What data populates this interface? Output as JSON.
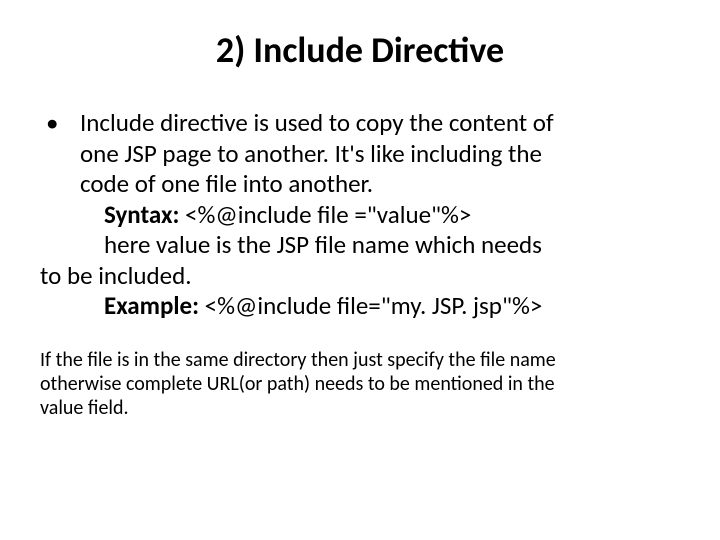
{
  "title": "2) Include Directive",
  "bullet_dot": "•",
  "para": {
    "l1": "Include directive is used to copy the content of",
    "l2": "one JSP page to another. It's like including the",
    "l3": "code of one file into another."
  },
  "syntax": {
    "label": "Syntax:",
    "text": " <%@include file =\"value\"%>"
  },
  "desc": {
    "l1": "here value is the JSP file name which needs",
    "l2": "to be included."
  },
  "example": {
    "label": "Example:",
    "text": " <%@include file=\"my. JSP. jsp\"%>"
  },
  "note": {
    "l1": "If the file is in the same directory then just specify the file name",
    "l2": "otherwise complete URL(or path) needs to be mentioned in the",
    "l3": "value field."
  }
}
